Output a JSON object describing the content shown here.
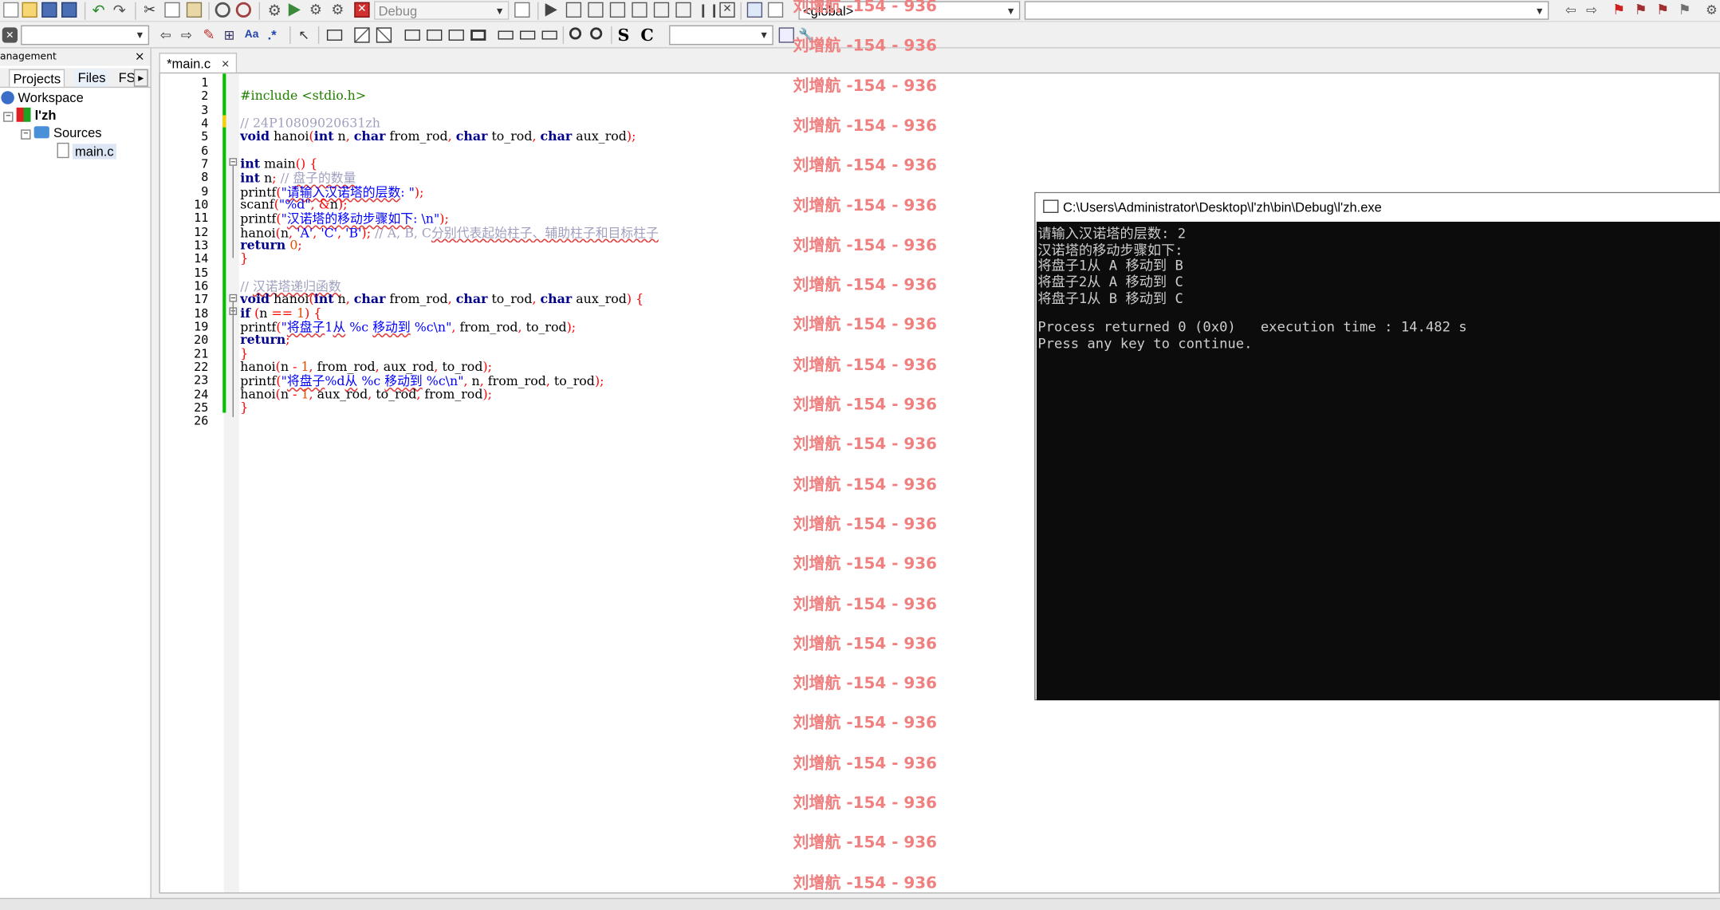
{
  "toolbar": {
    "build_target": "Debug",
    "scope_combo": "<global>",
    "search_combo": "",
    "symbol_combo": "",
    "select_combo": "",
    "s_label": "S",
    "c_label": "C",
    "aa_label": "Aa"
  },
  "management": {
    "title": "anagement",
    "close": "×",
    "tabs": [
      "Projects",
      "Files",
      "FS"
    ],
    "scroll_arrow": "▸",
    "tree": {
      "workspace": "Workspace",
      "project": "l'zh",
      "sources": "Sources",
      "file": "main.c"
    }
  },
  "editor": {
    "tab_label": "*main.c",
    "tab_close": "×",
    "line_numbers": [
      "1",
      "2",
      "3",
      "4",
      "5",
      "6",
      "7",
      "8",
      "9",
      "10",
      "11",
      "12",
      "13",
      "14",
      "15",
      "16",
      "17",
      "18",
      "19",
      "20",
      "21",
      "22",
      "23",
      "24",
      "25",
      "26"
    ],
    "lines": [
      "",
      "#include <stdio.h>",
      "",
      "// 24P10809020631zh",
      "void hanoi(int n, char from_rod, char to_rod, char aux_rod);",
      "",
      "int main() {",
      "int n; // 盘子的数量",
      "printf(\"请输入汉诺塔的层数: \");",
      "scanf(\"%d\", &n);",
      "printf(\"汉诺塔的移动步骤如下: \\n\");",
      "hanoi(n, 'A', 'C', 'B'); // A, B, C分别代表起始柱子、辅助柱子和目标柱子",
      "return 0;",
      "}",
      "",
      "// 汉诺塔递归函数",
      "void hanoi(int n, char from_rod, char to_rod, char aux_rod) {",
      "if (n == 1) {",
      "printf(\"将盘子1从 %c 移动到 %c\\n\", from_rod, to_rod);",
      "return;",
      "}",
      "hanoi(n - 1, from_rod, aux_rod, to_rod);",
      "printf(\"将盘子%d从 %c 移动到 %c\\n\", n, from_rod, to_rod);",
      "hanoi(n - 1, aux_rod, to_rod, from_rod);",
      "}",
      ""
    ]
  },
  "watermark": {
    "text": "刘增航 -154 - 936",
    "color": "#f08080"
  },
  "console": {
    "title": "C:\\Users\\Administrator\\Desktop\\l'zh\\bin\\Debug\\l'zh.exe",
    "lines": [
      "请输入汉诺塔的层数: 2",
      "汉诺塔的移动步骤如下:",
      "将盘子1从 A 移动到 B",
      "将盘子2从 A 移动到 C",
      "将盘子1从 B 移动到 C",
      "",
      "Process returned 0 (0x0)   execution time : 14.482 s",
      "Press any key to continue."
    ]
  },
  "colors": {
    "keyword": "#00008b",
    "string": "#0000ff",
    "number": "#e05000",
    "preprocessor": "#208000",
    "comment": "#a0a0c0",
    "changebar_saved": "#00c000",
    "changebar_modified": "#ffd000"
  }
}
